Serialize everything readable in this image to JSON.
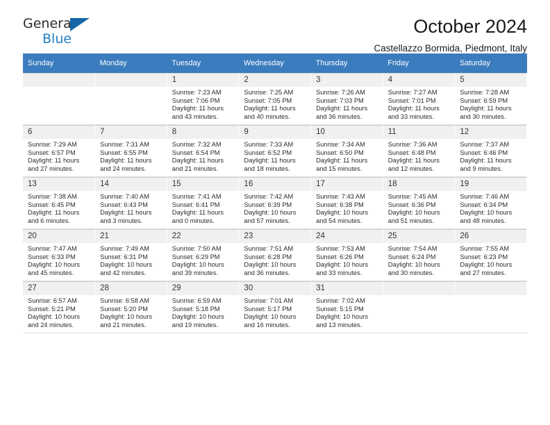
{
  "brand": {
    "name_top": "General",
    "name_bottom": "Blue",
    "triangle_color": "#1565a8",
    "blue_text_color": "#1f7ec2"
  },
  "header": {
    "title": "October 2024",
    "subtitle": "Castellazzo Bormida, Piedmont, Italy",
    "header_bg": "#3a7cbe"
  },
  "weekdays": [
    "Sunday",
    "Monday",
    "Tuesday",
    "Wednesday",
    "Thursday",
    "Friday",
    "Saturday"
  ],
  "labels": {
    "sunrise_prefix": "Sunrise: ",
    "sunset_prefix": "Sunset: ",
    "daylight_prefix": "Daylight: "
  },
  "weeks": [
    [
      {
        "day": "",
        "sunrise": "",
        "sunset": "",
        "daylight": ""
      },
      {
        "day": "",
        "sunrise": "",
        "sunset": "",
        "daylight": ""
      },
      {
        "day": "1",
        "sunrise": "Sunrise: 7:23 AM",
        "sunset": "Sunset: 7:06 PM",
        "daylight": "Daylight: 11 hours and 43 minutes."
      },
      {
        "day": "2",
        "sunrise": "Sunrise: 7:25 AM",
        "sunset": "Sunset: 7:05 PM",
        "daylight": "Daylight: 11 hours and 40 minutes."
      },
      {
        "day": "3",
        "sunrise": "Sunrise: 7:26 AM",
        "sunset": "Sunset: 7:03 PM",
        "daylight": "Daylight: 11 hours and 36 minutes."
      },
      {
        "day": "4",
        "sunrise": "Sunrise: 7:27 AM",
        "sunset": "Sunset: 7:01 PM",
        "daylight": "Daylight: 11 hours and 33 minutes."
      },
      {
        "day": "5",
        "sunrise": "Sunrise: 7:28 AM",
        "sunset": "Sunset: 6:59 PM",
        "daylight": "Daylight: 11 hours and 30 minutes."
      }
    ],
    [
      {
        "day": "6",
        "sunrise": "Sunrise: 7:29 AM",
        "sunset": "Sunset: 6:57 PM",
        "daylight": "Daylight: 11 hours and 27 minutes."
      },
      {
        "day": "7",
        "sunrise": "Sunrise: 7:31 AM",
        "sunset": "Sunset: 6:55 PM",
        "daylight": "Daylight: 11 hours and 24 minutes."
      },
      {
        "day": "8",
        "sunrise": "Sunrise: 7:32 AM",
        "sunset": "Sunset: 6:54 PM",
        "daylight": "Daylight: 11 hours and 21 minutes."
      },
      {
        "day": "9",
        "sunrise": "Sunrise: 7:33 AM",
        "sunset": "Sunset: 6:52 PM",
        "daylight": "Daylight: 11 hours and 18 minutes."
      },
      {
        "day": "10",
        "sunrise": "Sunrise: 7:34 AM",
        "sunset": "Sunset: 6:50 PM",
        "daylight": "Daylight: 11 hours and 15 minutes."
      },
      {
        "day": "11",
        "sunrise": "Sunrise: 7:36 AM",
        "sunset": "Sunset: 6:48 PM",
        "daylight": "Daylight: 11 hours and 12 minutes."
      },
      {
        "day": "12",
        "sunrise": "Sunrise: 7:37 AM",
        "sunset": "Sunset: 6:46 PM",
        "daylight": "Daylight: 11 hours and 9 minutes."
      }
    ],
    [
      {
        "day": "13",
        "sunrise": "Sunrise: 7:38 AM",
        "sunset": "Sunset: 6:45 PM",
        "daylight": "Daylight: 11 hours and 6 minutes."
      },
      {
        "day": "14",
        "sunrise": "Sunrise: 7:40 AM",
        "sunset": "Sunset: 6:43 PM",
        "daylight": "Daylight: 11 hours and 3 minutes."
      },
      {
        "day": "15",
        "sunrise": "Sunrise: 7:41 AM",
        "sunset": "Sunset: 6:41 PM",
        "daylight": "Daylight: 11 hours and 0 minutes."
      },
      {
        "day": "16",
        "sunrise": "Sunrise: 7:42 AM",
        "sunset": "Sunset: 6:39 PM",
        "daylight": "Daylight: 10 hours and 57 minutes."
      },
      {
        "day": "17",
        "sunrise": "Sunrise: 7:43 AM",
        "sunset": "Sunset: 6:38 PM",
        "daylight": "Daylight: 10 hours and 54 minutes."
      },
      {
        "day": "18",
        "sunrise": "Sunrise: 7:45 AM",
        "sunset": "Sunset: 6:36 PM",
        "daylight": "Daylight: 10 hours and 51 minutes."
      },
      {
        "day": "19",
        "sunrise": "Sunrise: 7:46 AM",
        "sunset": "Sunset: 6:34 PM",
        "daylight": "Daylight: 10 hours and 48 minutes."
      }
    ],
    [
      {
        "day": "20",
        "sunrise": "Sunrise: 7:47 AM",
        "sunset": "Sunset: 6:33 PM",
        "daylight": "Daylight: 10 hours and 45 minutes."
      },
      {
        "day": "21",
        "sunrise": "Sunrise: 7:49 AM",
        "sunset": "Sunset: 6:31 PM",
        "daylight": "Daylight: 10 hours and 42 minutes."
      },
      {
        "day": "22",
        "sunrise": "Sunrise: 7:50 AM",
        "sunset": "Sunset: 6:29 PM",
        "daylight": "Daylight: 10 hours and 39 minutes."
      },
      {
        "day": "23",
        "sunrise": "Sunrise: 7:51 AM",
        "sunset": "Sunset: 6:28 PM",
        "daylight": "Daylight: 10 hours and 36 minutes."
      },
      {
        "day": "24",
        "sunrise": "Sunrise: 7:53 AM",
        "sunset": "Sunset: 6:26 PM",
        "daylight": "Daylight: 10 hours and 33 minutes."
      },
      {
        "day": "25",
        "sunrise": "Sunrise: 7:54 AM",
        "sunset": "Sunset: 6:24 PM",
        "daylight": "Daylight: 10 hours and 30 minutes."
      },
      {
        "day": "26",
        "sunrise": "Sunrise: 7:55 AM",
        "sunset": "Sunset: 6:23 PM",
        "daylight": "Daylight: 10 hours and 27 minutes."
      }
    ],
    [
      {
        "day": "27",
        "sunrise": "Sunrise: 6:57 AM",
        "sunset": "Sunset: 5:21 PM",
        "daylight": "Daylight: 10 hours and 24 minutes."
      },
      {
        "day": "28",
        "sunrise": "Sunrise: 6:58 AM",
        "sunset": "Sunset: 5:20 PM",
        "daylight": "Daylight: 10 hours and 21 minutes."
      },
      {
        "day": "29",
        "sunrise": "Sunrise: 6:59 AM",
        "sunset": "Sunset: 5:18 PM",
        "daylight": "Daylight: 10 hours and 19 minutes."
      },
      {
        "day": "30",
        "sunrise": "Sunrise: 7:01 AM",
        "sunset": "Sunset: 5:17 PM",
        "daylight": "Daylight: 10 hours and 16 minutes."
      },
      {
        "day": "31",
        "sunrise": "Sunrise: 7:02 AM",
        "sunset": "Sunset: 5:15 PM",
        "daylight": "Daylight: 10 hours and 13 minutes."
      },
      {
        "day": "",
        "sunrise": "",
        "sunset": "",
        "daylight": ""
      },
      {
        "day": "",
        "sunrise": "",
        "sunset": "",
        "daylight": ""
      }
    ]
  ]
}
